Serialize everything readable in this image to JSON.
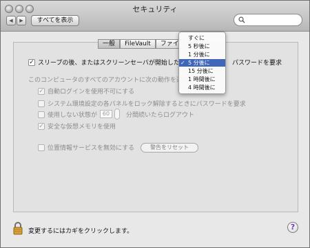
{
  "window": {
    "title": "セキュリティ"
  },
  "toolbar": {
    "show_all": "すべてを表示",
    "back_icon": "chevron-left-icon",
    "forward_icon": "chevron-right-icon",
    "search_placeholder": ""
  },
  "tabs": [
    {
      "label": "一般",
      "active": true
    },
    {
      "label": "FileVault",
      "active": false
    },
    {
      "label": "ファイ",
      "active": false
    }
  ],
  "main": {
    "require_password": {
      "checked": true,
      "label_prefix": "スリープの後、またはスクリーンセーバが開始した後",
      "label_suffix": "パスワードを要求"
    },
    "accounts_heading": "このコンピュータのすべてのアカウントに次の動作を適用",
    "options": [
      {
        "label": "自動ログインを使用不可にする",
        "checked": true
      },
      {
        "label": "システム環境設定の各パネルをロック解除するときにパスワードを要求",
        "checked": false
      },
      {
        "label_prefix": "使用しない状態が",
        "value": "60",
        "label_suffix": "分間続いたらログアウト",
        "checked": false
      },
      {
        "label": "安全な仮想メモリを使用",
        "checked": true
      }
    ],
    "location": {
      "label": "位置情報サービスを無効にする",
      "checked": false,
      "button": "警告をリセット"
    }
  },
  "dropdown": {
    "selected_index": 4,
    "items": [
      "すぐに",
      "5 秒後に",
      "1 分後に",
      "5 分後に",
      "15 分後に",
      "1 時間後に",
      "4 時間後に"
    ],
    "checkmark": "✓"
  },
  "footer": {
    "text": "変更するにはカギをクリックします。",
    "lock_icon": "lock-icon",
    "help": "?"
  },
  "colors": {
    "selection": "#3f66b8",
    "help": "#6b3bbf"
  }
}
